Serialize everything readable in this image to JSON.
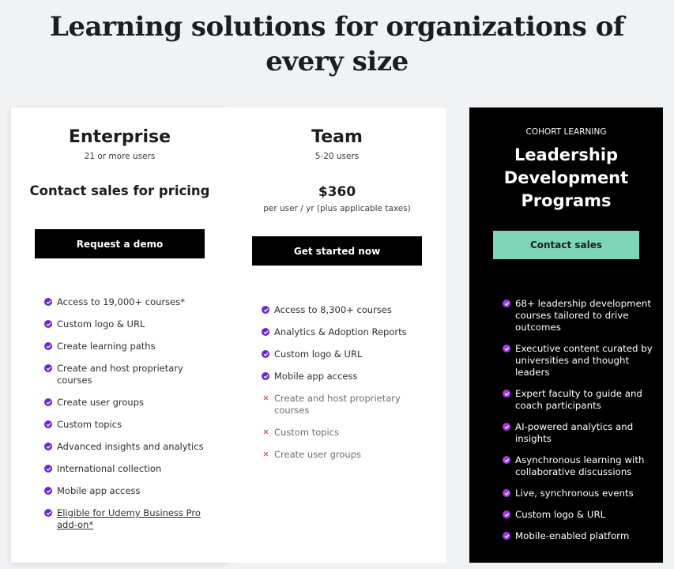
{
  "headline": {
    "line1": "Learning solutions for organizations of",
    "line2": "every size"
  },
  "enterprise": {
    "name": "Enterprise",
    "users": "21 or more users",
    "pricing": "Contact sales for pricing",
    "cta": "Request a demo",
    "features": [
      {
        "lines": [
          "Access to 19,000+ courses*"
        ],
        "included": true
      },
      {
        "lines": [
          "Custom logo & URL"
        ],
        "included": true
      },
      {
        "lines": [
          "Create learning paths"
        ],
        "included": true
      },
      {
        "lines": [
          "Create and host proprietary",
          "courses"
        ],
        "included": true
      },
      {
        "lines": [
          "Create user groups"
        ],
        "included": true
      },
      {
        "lines": [
          "Custom topics"
        ],
        "included": true
      },
      {
        "lines": [
          "Advanced insights and analytics"
        ],
        "included": true
      },
      {
        "lines": [
          "International collection"
        ],
        "included": true
      },
      {
        "lines": [
          "Mobile app access"
        ],
        "included": true
      },
      {
        "lines": [
          "Eligible for Udemy Business Pro",
          "add-on*"
        ],
        "included": true,
        "link": true
      }
    ]
  },
  "team": {
    "name": "Team",
    "users": "5-20 users",
    "price": "$360",
    "price_note": "per user / yr (plus applicable taxes)",
    "cta": "Get started now",
    "features": [
      {
        "lines": [
          "Access to 8,300+ courses"
        ],
        "included": true
      },
      {
        "lines": [
          "Analytics & Adoption Reports"
        ],
        "included": true
      },
      {
        "lines": [
          "Custom logo & URL"
        ],
        "included": true
      },
      {
        "lines": [
          "Mobile app access"
        ],
        "included": true
      },
      {
        "lines": [
          "Create and host proprietary",
          "courses"
        ],
        "included": false
      },
      {
        "lines": [
          "Custom topics"
        ],
        "included": false
      },
      {
        "lines": [
          "Create user groups"
        ],
        "included": false
      }
    ]
  },
  "cohort": {
    "eyebrow": "COHORT LEARNING",
    "title_lines": [
      "Leadership",
      "Development",
      "Programs"
    ],
    "cta": "Contact sales",
    "features": [
      {
        "lines": [
          "68+ leadership development",
          "courses tailored to drive",
          "outcomes"
        ],
        "included": true
      },
      {
        "lines": [
          "Executive content curated by",
          "universities and thought",
          "leaders"
        ],
        "included": true
      },
      {
        "lines": [
          "Expert faculty to guide and",
          "coach participants"
        ],
        "included": true
      },
      {
        "lines": [
          "AI-powered analytics and",
          "insights"
        ],
        "included": true
      },
      {
        "lines": [
          "Asynchronous learning with",
          "collaborative discussions"
        ],
        "included": true
      },
      {
        "lines": [
          "Live, synchronous events"
        ],
        "included": true
      },
      {
        "lines": [
          "Custom logo & URL"
        ],
        "included": true
      },
      {
        "lines": [
          "Mobile-enabled platform"
        ],
        "included": true
      }
    ]
  },
  "colors": {
    "page_bg": "#f1f2f4",
    "check": "#6d28d2",
    "check_cohort": "#a435f0",
    "cross": "#d14b3c",
    "mint_button": "#7fd5b7",
    "dark_button": "#000000"
  },
  "icons": {
    "included": "check-circle-icon",
    "excluded": "cross-icon"
  }
}
